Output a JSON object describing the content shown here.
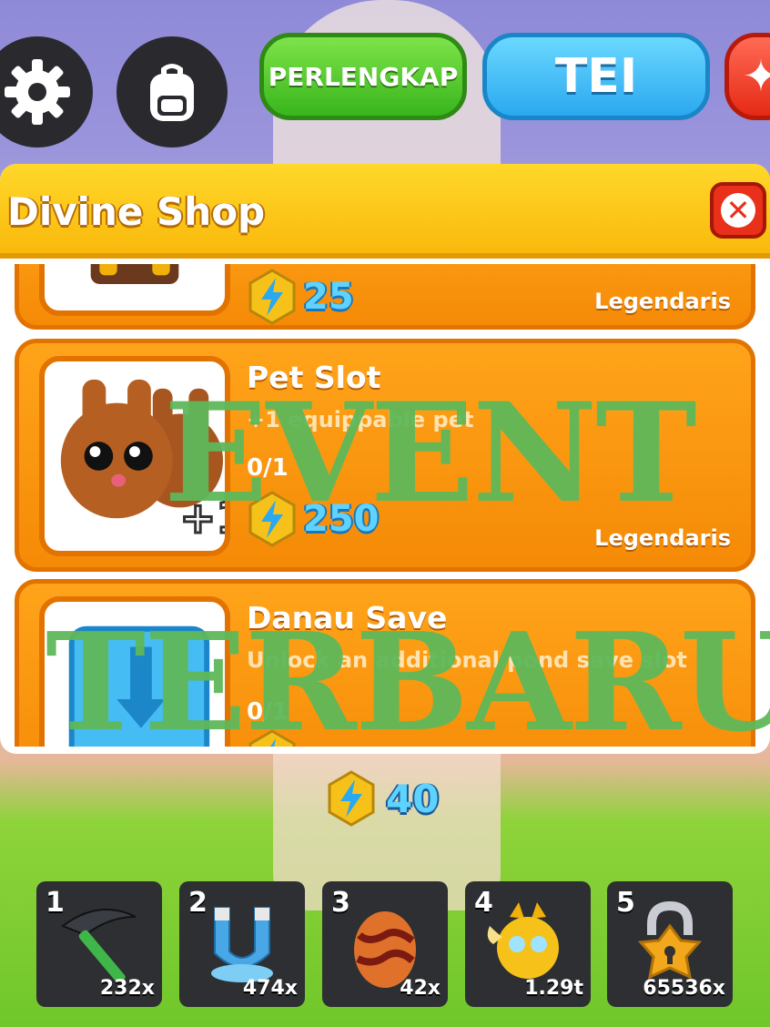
{
  "top_bar": {
    "equipment_button": "PERLENGKAP",
    "tele_button": "TEI"
  },
  "shop": {
    "title": "Divine Shop",
    "items": [
      {
        "name": "",
        "description": "",
        "count": "",
        "price": "25",
        "rarity": "Legendaris"
      },
      {
        "name": "Pet Slot",
        "description": "+1 equippable pet",
        "count": "0/1",
        "price": "250",
        "rarity": "Legendaris"
      },
      {
        "name": "Danau Save",
        "description": "Unlock an additional pond save slot",
        "count": "0/1",
        "price": "",
        "rarity": ""
      }
    ]
  },
  "watermark": {
    "line1": "EVENT",
    "line2": "TERBARU"
  },
  "currency": {
    "amount": "40"
  },
  "hotbar": [
    {
      "index": "1",
      "item": "pickaxe",
      "qty": "232x"
    },
    {
      "index": "2",
      "item": "magnet",
      "qty": "474x"
    },
    {
      "index": "3",
      "item": "lava-egg",
      "qty": "42x"
    },
    {
      "index": "4",
      "item": "golden-pet",
      "qty": "1.29t"
    },
    {
      "index": "5",
      "item": "lock",
      "qty": "65536x"
    }
  ],
  "colors": {
    "accent_orange": "#f58a06",
    "gem_blue": "#5fd3ff",
    "header_yellow": "#ffd82a"
  }
}
